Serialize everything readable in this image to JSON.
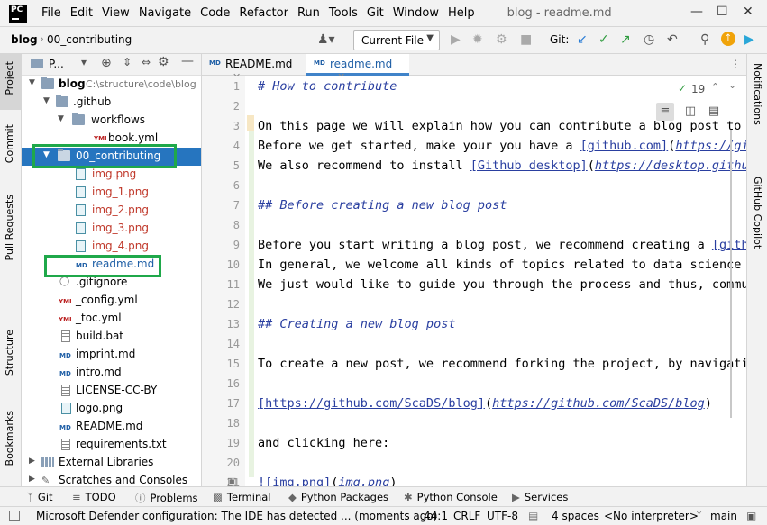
{
  "app": {
    "icon_text": "PC",
    "window_title": "blog - readme.md"
  },
  "menu": [
    "File",
    "Edit",
    "View",
    "Navigate",
    "Code",
    "Refactor",
    "Run",
    "Tools",
    "Git",
    "Window",
    "Help"
  ],
  "navbar": {
    "breadcrumb": [
      "blog",
      "00_contributing"
    ],
    "run_config": "Current File",
    "git_label": "Git:"
  },
  "left_tabs": [
    "Project",
    "Commit",
    "Pull Requests",
    "Structure",
    "Bookmarks"
  ],
  "right_tabs": [
    "Notifications",
    "GitHub Copilot"
  ],
  "project_panel": {
    "title": "P..."
  },
  "tree": [
    {
      "label": "blog",
      "hint": "C:\\structure\\code\\blog"
    },
    {
      "label": ".github"
    },
    {
      "label": "workflows"
    },
    {
      "label": "book.yml"
    },
    {
      "label": "00_contributing"
    },
    {
      "label": "img.png"
    },
    {
      "label": "img_1.png"
    },
    {
      "label": "img_2.png"
    },
    {
      "label": "img_3.png"
    },
    {
      "label": "img_4.png"
    },
    {
      "label": "readme.md"
    },
    {
      "label": ".gitignore"
    },
    {
      "label": "_config.yml"
    },
    {
      "label": "_toc.yml"
    },
    {
      "label": "build.bat"
    },
    {
      "label": "imprint.md"
    },
    {
      "label": "intro.md"
    },
    {
      "label": "LICENSE-CC-BY"
    },
    {
      "label": "logo.png"
    },
    {
      "label": "README.md"
    },
    {
      "label": "requirements.txt"
    },
    {
      "label": "External Libraries"
    },
    {
      "label": "Scratches and Consoles"
    }
  ],
  "editor_tabs": [
    "README.md",
    "readme.md"
  ],
  "editor": {
    "inspections_count": "19",
    "line_numbers": [
      "1",
      "2",
      "3",
      "4",
      "5",
      "6",
      "7",
      "8",
      "9",
      "10",
      "11",
      "12",
      "13",
      "14",
      "15",
      "16",
      "17",
      "18",
      "19",
      "20",
      "21"
    ],
    "lines": {
      "l1": "# How to contribute",
      "l3": "On this page we will explain how you can contribute a blog post to t",
      "l4a": "Before we get started, make your you have a ",
      "l4b": "[github.com]",
      "l4c": "(",
      "l4d": "https://git",
      "l5a": "We also recommend to install ",
      "l5b": "[Github desktop]",
      "l5c": "(",
      "l5d": "https://desktop.github",
      "l7": "## Before creating a new blog post",
      "l9a": "Before you start writing a blog post, we recommend creating a ",
      "l9b": "[githu",
      "l10": "In general, we welcome all kinds of topics related to data science a",
      "l11": "We just would like to guide you through the process and thus, commun",
      "l13": "## Creating a new blog post",
      "l15": "To create a new post, we recommend forking the project, by navigatin",
      "l17a": "[https://github.com/ScaDS/blog]",
      "l17b": "(",
      "l17c": "https://github.com/ScaDS/blog",
      "l17d": ")",
      "l19": "and clicking here:",
      "l21a": "![img.png]",
      "l21b": "(",
      "l21c": "img.png",
      "l21d": ")"
    }
  },
  "tool_windows": [
    "Git",
    "TODO",
    "Problems",
    "Terminal",
    "Python Packages",
    "Python Console",
    "Services"
  ],
  "statusbar": {
    "message": "Microsoft Defender configuration: The IDE has detected ... (moments ago)",
    "position": "44:1",
    "line_sep": "CRLF",
    "encoding": "UTF-8",
    "indent": "4 spaces",
    "interpreter": "<No interpreter>",
    "branch": "main"
  },
  "colors": {
    "selection": "#2675bf",
    "highlight_box": "#1fa84a",
    "link": "#2a3fa0"
  }
}
